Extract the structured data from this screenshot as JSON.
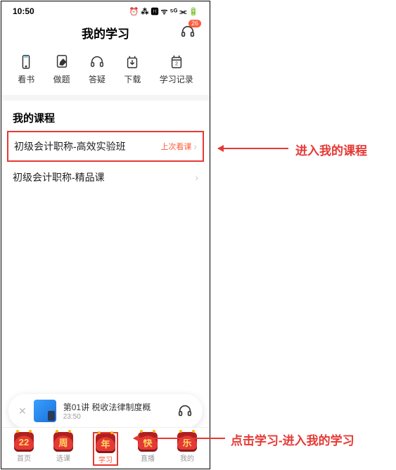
{
  "status": {
    "time": "10:50",
    "icons": "⏰ ⁂ 🅷 ᯤ ⁵ᴳ ⫘ 🔋"
  },
  "header": {
    "title": "我的学习",
    "badge": "26"
  },
  "actions": [
    {
      "label": "看书"
    },
    {
      "label": "做题"
    },
    {
      "label": "答疑"
    },
    {
      "label": "下载"
    },
    {
      "label": "学习记录"
    }
  ],
  "section_title": "我的课程",
  "courses": [
    {
      "name": "初级会计职称-高效实验班",
      "tag": "上次看课",
      "highlighted": true
    },
    {
      "name": "初级会计职称-精品课",
      "tag": "",
      "highlighted": false
    }
  ],
  "player": {
    "title": "第01讲  税收法律制度概",
    "time": "23:50"
  },
  "nav": [
    {
      "label": "首页",
      "glyph": "22"
    },
    {
      "label": "选课",
      "glyph": "周"
    },
    {
      "label": "学习",
      "glyph": "年"
    },
    {
      "label": "直播",
      "glyph": "快"
    },
    {
      "label": "我的",
      "glyph": "乐"
    }
  ],
  "annotations": {
    "course": "进入我的课程",
    "nav": "点击学习-进入我的学习"
  }
}
